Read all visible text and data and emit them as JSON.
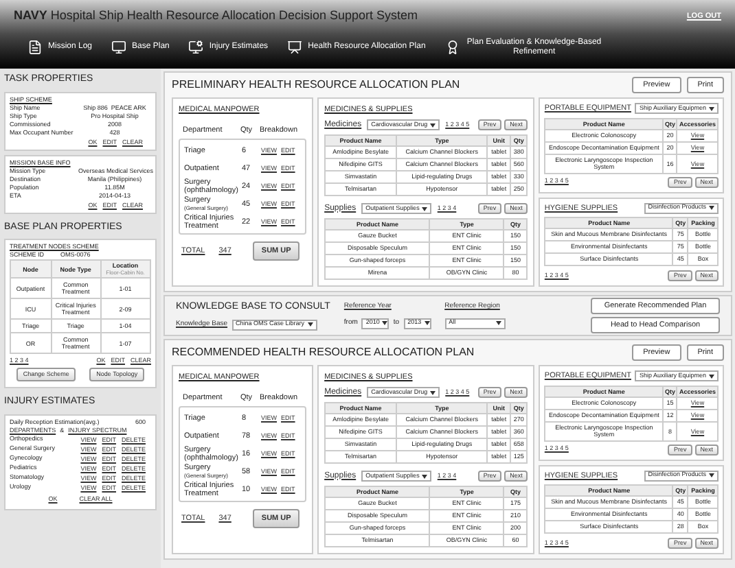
{
  "header": {
    "brand": "NAVY",
    "title": "Hospital Ship Health Resource Allocation Decision Support System",
    "logout": "LOG OUT"
  },
  "nav": [
    {
      "label": "Mission Log",
      "kind": "document"
    },
    {
      "label": "Base Plan",
      "kind": "monitor"
    },
    {
      "label": "Injury Estimates",
      "kind": "estimate"
    },
    {
      "label": "Health Resource Allocation Plan",
      "kind": "plan"
    },
    {
      "label": "Plan Evaluation & Knowledge-Based Refinement",
      "kind": "evaluation"
    }
  ],
  "task_properties": {
    "title": "TASK PROPERTIES",
    "sections": [
      {
        "title": "SHIP SCHEME",
        "fields": [
          {
            "label": "Ship Name",
            "value": "Ship 886  PEACE ARK"
          },
          {
            "label": "Ship Type",
            "value": "Pro Hospital Ship"
          },
          {
            "label": "Commissioned",
            "value": "2008"
          },
          {
            "label": "Max Occupant Number",
            "value": "428"
          }
        ],
        "actions": [
          "OK",
          "EDIT",
          "CLEAR"
        ]
      },
      {
        "title": "MISSION BASE INFO",
        "fields": [
          {
            "label": "Mission Type",
            "value": "Overseas Medical Services"
          },
          {
            "label": "Destination",
            "value": "Manila (Philippines)"
          },
          {
            "label": "Population",
            "value": "11.85M"
          },
          {
            "label": "ETA",
            "value": "2014-04-13"
          }
        ],
        "actions": [
          "OK",
          "EDIT",
          "CLEAR"
        ]
      }
    ]
  },
  "base_plan": {
    "title": "BASE PLAN PROPERTIES",
    "scheme_title": "TREATMENT NODES SCHEME",
    "scheme_label": "SCHEME ID",
    "scheme_id": "OMS-0076",
    "columns": [
      "Node",
      "Node Type",
      "Location"
    ],
    "location_sub": "Floor-Cabin No.",
    "rows": [
      [
        "Outpatient",
        "Common Treatment",
        "1-01"
      ],
      [
        "ICU",
        "Critical Injuries Treatment",
        "2-09"
      ],
      [
        "Triage",
        "Triage",
        "1-04"
      ],
      [
        "OR",
        "Common Treatment",
        "1-07"
      ]
    ],
    "pager": "1 2 3 4",
    "actions": [
      "OK",
      "EDIT",
      "CLEAR"
    ],
    "buttons": [
      "Change Scheme",
      "Node Topology"
    ]
  },
  "injury": {
    "title": "INJURY ESTIMATES",
    "reception_label": "Daily Reception Estimation(avg.)",
    "reception_value": "600",
    "departments_link": "DEPARTMENTS",
    "amp": "&",
    "spectrum_link": "INJURY SPECTRUM",
    "rows": [
      {
        "name": "Orthopedics",
        "actions": [
          "VIEW",
          "EDIT",
          "DELETE"
        ]
      },
      {
        "name": "General Surgery",
        "actions": [
          "VIEW",
          "EDIT",
          "DELETE"
        ]
      },
      {
        "name": "Gynecology",
        "actions": [
          "VIEW",
          "EDIT",
          "DELETE"
        ]
      },
      {
        "name": "Pediatrics",
        "actions": [
          "VIEW",
          "EDIT",
          "DELETE"
        ]
      },
      {
        "name": "Stomatology",
        "actions": [
          "VIEW",
          "EDIT",
          "DELETE"
        ]
      },
      {
        "name": "Urology",
        "actions": [
          "VIEW",
          "EDIT",
          "DELETE"
        ]
      }
    ],
    "footer": [
      "OK",
      "CLEAR ALL"
    ]
  },
  "plans": [
    {
      "title": "PRELIMINARY HEALTH RESOURCE ALLOCATION PLAN",
      "buttons": [
        "Preview",
        "Print"
      ],
      "manpower": {
        "title": "MEDICAL MANPOWER",
        "columns": [
          "Department",
          "Qty",
          "Breakdown"
        ],
        "rows": [
          {
            "department": "Triage",
            "qty": "6",
            "actions": [
              "VIEW",
              "EDIT"
            ]
          },
          {
            "department": "Outpatient",
            "qty": "47",
            "actions": [
              "VIEW",
              "EDIT"
            ]
          },
          {
            "department": "Surgery (ophthalmology)",
            "qty": "24",
            "actions": [
              "VIEW",
              "EDIT"
            ]
          },
          {
            "department": "Surgery",
            "note": "(General Surgery)",
            "qty": "45",
            "actions": [
              "VIEW",
              "EDIT"
            ]
          },
          {
            "department": "Critical Injuries Treatment",
            "qty": "22",
            "actions": [
              "VIEW",
              "EDIT"
            ]
          }
        ],
        "total_label": "TOTAL",
        "total": "347",
        "sum_button": "SUM UP"
      },
      "supplies": {
        "title": "MEDICINES & SUPPLIES",
        "groups": [
          {
            "label": "Medicines",
            "dropdown": "Cardiovascular Drug",
            "pager": "1 2 3 4 5",
            "buttons": [
              "Prev",
              "Next"
            ],
            "table": {
              "columns": [
                {
                  "label": "Product Name",
                  "kind": "text"
                },
                {
                  "label": "Type",
                  "kind": "text"
                },
                {
                  "label": "Unit",
                  "kind": "text"
                },
                {
                  "label": "Qty",
                  "kind": "text"
                }
              ],
              "rows": [
                [
                  "Amlodipine Besylate",
                  "Calcium Channel Blockers",
                  "tablet",
                  "380"
                ],
                [
                  "Nifedipine GITS",
                  "Calcium Channel Blockers",
                  "tablet",
                  "560"
                ],
                [
                  "Simvastatin",
                  "Lipid-regulating Drugs",
                  "tablet",
                  "330"
                ],
                [
                  "Telmisartan",
                  "Hypotensor",
                  "tablet",
                  "250"
                ]
              ]
            }
          },
          {
            "label": "Supplies",
            "dropdown": "Outpatient Supplies",
            "pager": "1 2 3 4",
            "buttons": [
              "Prev",
              "Next"
            ],
            "table": {
              "columns": [
                {
                  "label": "Product Name",
                  "kind": "text"
                },
                {
                  "label": "Type",
                  "kind": "text"
                },
                {
                  "label": "Qty",
                  "kind": "text"
                }
              ],
              "rows": [
                [
                  "Gauze Bucket",
                  "ENT Clinic",
                  "150"
                ],
                [
                  "Disposable Speculum",
                  "ENT Clinic",
                  "150"
                ],
                [
                  "Gun-shaped forceps",
                  "ENT Clinic",
                  "150"
                ],
                [
                  "Mirena",
                  "OB/GYN Clinic",
                  "80"
                ]
              ]
            }
          }
        ]
      },
      "equipment": [
        {
          "title": "PORTABLE EQUIPMENT",
          "dropdown": "Ship Auxiliary Equipmen",
          "pager": "1 2 3 4 5",
          "buttons": [
            "Prev",
            "Next"
          ],
          "table": {
            "columns": [
              {
                "label": "Product Name",
                "kind": "text"
              },
              {
                "label": "Qty",
                "kind": "text"
              },
              {
                "label": "Accessories",
                "kind": "link"
              }
            ],
            "rows": [
              [
                "Electronic Colonoscopy",
                "20",
                "View"
              ],
              [
                "Endoscope Decontamination Equipment",
                "20",
                "View"
              ],
              [
                "Electronic Laryngoscope Inspection System",
                "16",
                "View"
              ]
            ]
          }
        },
        {
          "title": "HYGIENE SUPPLIES",
          "dropdown": "Disinfection Products",
          "pager": "1 2 3 4 5",
          "buttons": [
            "Prev",
            "Next"
          ],
          "table": {
            "columns": [
              {
                "label": "Product Name",
                "kind": "text"
              },
              {
                "label": "Qty",
                "kind": "text"
              },
              {
                "label": "Packing",
                "kind": "text"
              }
            ],
            "rows": [
              [
                "Skin and Mucous Membrane Disinfectants",
                "75",
                "Bottle"
              ],
              [
                "Environmental Disinfectants",
                "75",
                "Bottle"
              ],
              [
                "Surface Disinfectants",
                "45",
                "Box"
              ]
            ]
          }
        }
      ]
    },
    {
      "title": "RECOMMENDED HEALTH RESOURCE ALLOCATION PLAN",
      "buttons": [
        "Preview",
        "Print"
      ],
      "manpower": {
        "title": "MEDICAL MANPOWER",
        "columns": [
          "Department",
          "Qty",
          "Breakdown"
        ],
        "rows": [
          {
            "department": "Triage",
            "qty": "8",
            "actions": [
              "VIEW",
              "EDIT"
            ]
          },
          {
            "department": "Outpatient",
            "qty": "78",
            "actions": [
              "VIEW",
              "EDIT"
            ]
          },
          {
            "department": "Surgery (ophthalmology)",
            "qty": "16",
            "actions": [
              "VIEW",
              "EDIT"
            ]
          },
          {
            "department": "Surgery",
            "note": "(General Surgery)",
            "qty": "58",
            "actions": [
              "VIEW",
              "EDIT"
            ]
          },
          {
            "department": "Critical Injuries Treatment",
            "qty": "10",
            "actions": [
              "VIEW",
              "EDIT"
            ]
          }
        ],
        "total_label": "TOTAL",
        "total": "347",
        "sum_button": "SUM UP"
      },
      "supplies": {
        "title": "MEDICINES & SUPPLIES",
        "groups": [
          {
            "label": "Medicines",
            "dropdown": "Cardiovascular Drug",
            "pager": "1 2 3 4 5",
            "buttons": [
              "Prev",
              "Next"
            ],
            "table": {
              "columns": [
                {
                  "label": "Product Name",
                  "kind": "text"
                },
                {
                  "label": "Type",
                  "kind": "text"
                },
                {
                  "label": "Unit",
                  "kind": "text"
                },
                {
                  "label": "Qty",
                  "kind": "text"
                }
              ],
              "rows": [
                [
                  "Amlodipine Besylate",
                  "Calcium Channel Blockers",
                  "tablet",
                  "270"
                ],
                [
                  "Nifedipine GITS",
                  "Calcium Channel Blockers",
                  "tablet",
                  "360"
                ],
                [
                  "Simvastatin",
                  "Lipid-regulating Drugs",
                  "tablet",
                  "658"
                ],
                [
                  "Telmisartan",
                  "Hypotensor",
                  "tablet",
                  "125"
                ]
              ]
            }
          },
          {
            "label": "Supplies",
            "dropdown": "Outpatient Supplies",
            "pager": "1 2 3 4",
            "buttons": [
              "Prev",
              "Next"
            ],
            "table": {
              "columns": [
                {
                  "label": "Product Name",
                  "kind": "text"
                },
                {
                  "label": "Type",
                  "kind": "text"
                },
                {
                  "label": "Qty",
                  "kind": "text"
                }
              ],
              "rows": [
                [
                  "Gauze Bucket",
                  "ENT Clinic",
                  "175"
                ],
                [
                  "Disposable Speculum",
                  "ENT Clinic",
                  "210"
                ],
                [
                  "Gun-shaped forceps",
                  "ENT Clinic",
                  "200"
                ],
                [
                  "Telmisartan",
                  "OB/GYN Clinic",
                  "60"
                ]
              ]
            }
          }
        ]
      },
      "equipment": [
        {
          "title": "PORTABLE EQUIPMENT",
          "dropdown": "Ship Auxiliary Equipmen",
          "pager": "1 2 3 4 5",
          "buttons": [
            "Prev",
            "Next"
          ],
          "table": {
            "columns": [
              {
                "label": "Product Name",
                "kind": "text"
              },
              {
                "label": "Qty",
                "kind": "text"
              },
              {
                "label": "Accessories",
                "kind": "link"
              }
            ],
            "rows": [
              [
                "Electronic Colonoscopy",
                "15",
                "View"
              ],
              [
                "Endoscope Decontamination Equipment",
                "12",
                "View"
              ],
              [
                "Electronic Laryngoscope Inspection System",
                "8",
                "View"
              ]
            ]
          }
        },
        {
          "title": "HYGIENE SUPPLIES",
          "dropdown": "Disinfection Products",
          "pager": "1 2 3 4 5",
          "buttons": [
            "Prev",
            "Next"
          ],
          "table": {
            "columns": [
              {
                "label": "Product Name",
                "kind": "text"
              },
              {
                "label": "Qty",
                "kind": "text"
              },
              {
                "label": "Packing",
                "kind": "text"
              }
            ],
            "rows": [
              [
                "Skin and Mucous Membrane Disinfectants",
                "45",
                "Bottle"
              ],
              [
                "Environmental Disinfectants",
                "40",
                "Bottle"
              ],
              [
                "Surface Disinfectants",
                "28",
                "Box"
              ]
            ]
          }
        }
      ]
    }
  ],
  "knowledge": {
    "title": "KNOWLEDGE BASE TO CONSULT",
    "kb_label": "Knowledge Base",
    "kb_value": "China OMS Case Library",
    "year_label": "Reference Year",
    "from": "from",
    "from_value": "2010",
    "to": "to",
    "to_value": "2013",
    "region_label": "Reference Region",
    "region_value": "All",
    "buttons": [
      "Generate Recommended Plan",
      "Head to Head Comparison"
    ]
  }
}
